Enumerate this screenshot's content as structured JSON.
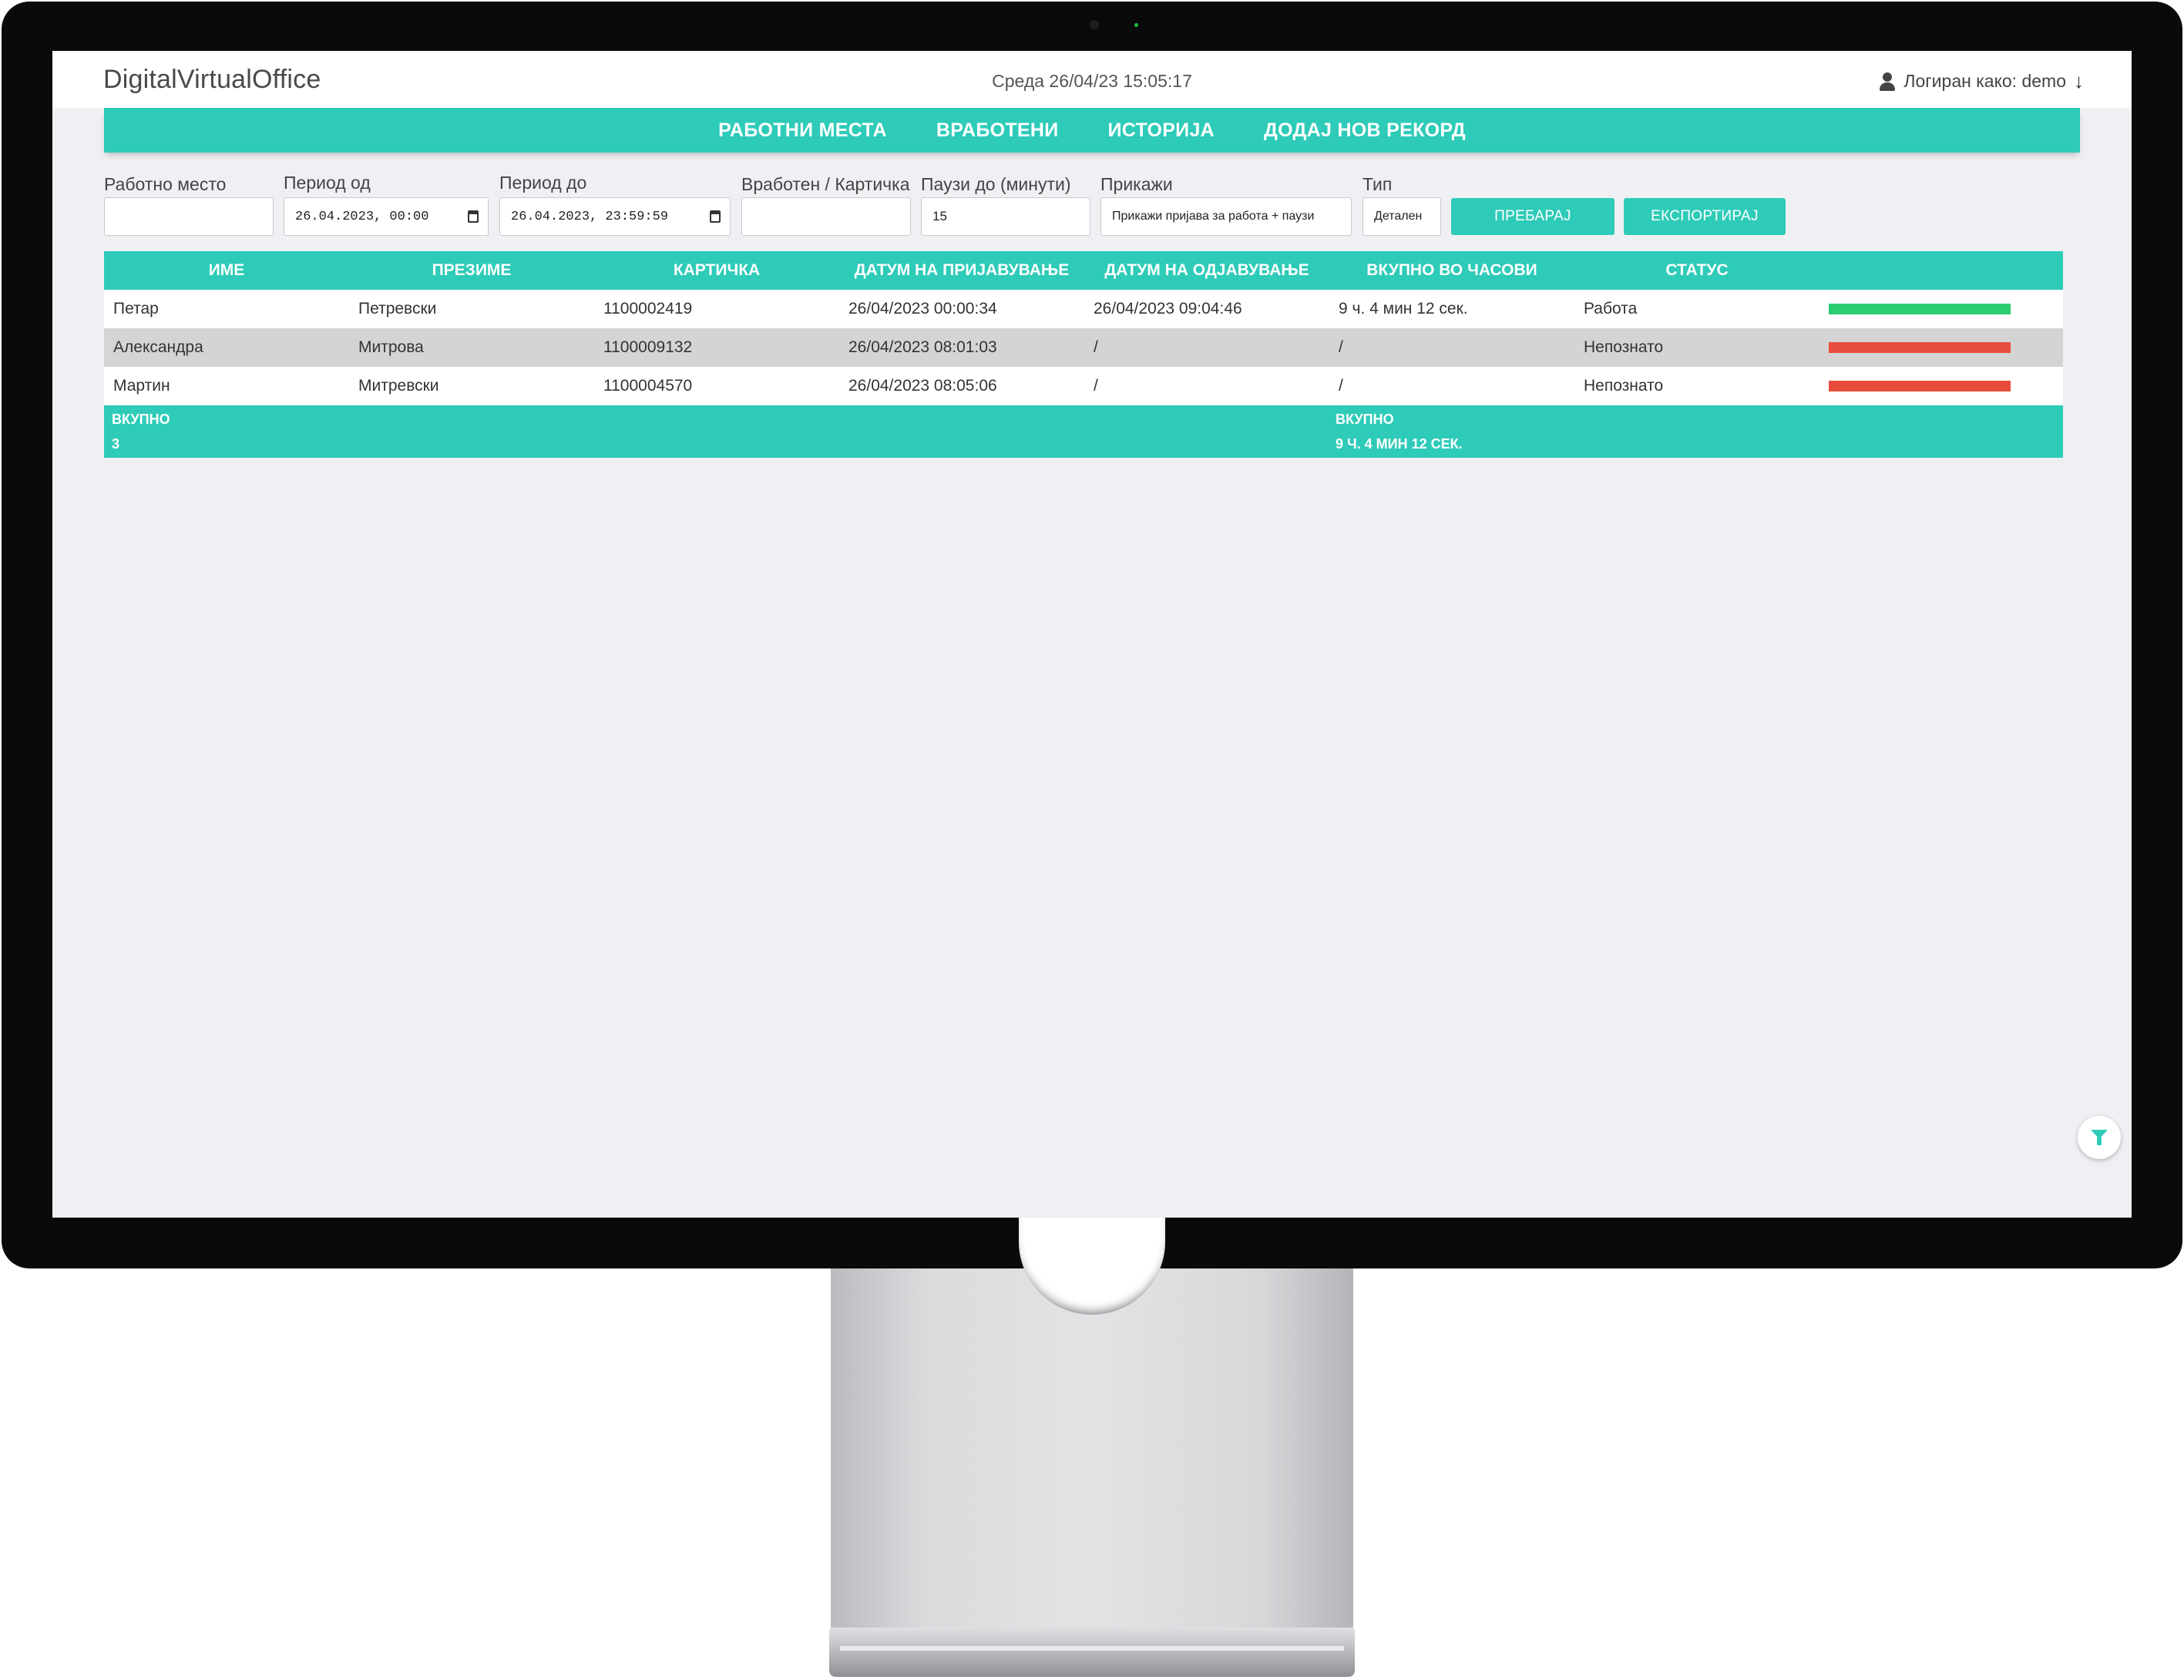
{
  "header": {
    "brand": "DigitalVirtualOffice",
    "clock": "Среда 26/04/23 15:05:17",
    "user": "Логиран како: demo"
  },
  "nav": [
    "РАБОТНИ МЕСТА",
    "ВРАБОТЕНИ",
    "ИСТОРИЈА",
    "ДОДАЈ НОВ РЕКОРД"
  ],
  "filters": {
    "workplace": {
      "label": "Работно место",
      "value": ""
    },
    "period_from": {
      "label": "Период од",
      "value": "26.04.2023, 00:00"
    },
    "period_to": {
      "label": "Период до",
      "value": "26.04.2023, 23:59:59"
    },
    "employee": {
      "label": "Вработен / Картичка",
      "value": ""
    },
    "breaks": {
      "label": "Паузи до (минути)",
      "value": "15"
    },
    "show": {
      "label": "Прикажи",
      "value": "Прикажи пријава за работа + паузи"
    },
    "type": {
      "label": "Тип",
      "value": "Детален"
    },
    "search_button": "ПРЕБАРАЈ",
    "export_button": "ЕКСПОРТИРАЈ"
  },
  "table": {
    "columns": [
      "ИМЕ",
      "ПРЕЗИМЕ",
      "КАРТИЧКА",
      "ДАТУМ НА ПРИЈАВУВАЊЕ",
      "ДАТУМ НА ОДЈАВУВАЊЕ",
      "ВКУПНО ВО ЧАСОВИ",
      "СТАТУС"
    ],
    "rows": [
      {
        "first": "Петар",
        "last": "Петревски",
        "card": "1100002419",
        "login": "26/04/2023 00:00:34",
        "logout": "26/04/2023 09:04:46",
        "total": "9 ч. 4 мин 12 сек.",
        "status": "Работа"
      },
      {
        "first": "Александра",
        "last": "Митрова",
        "card": "1100009132",
        "login": "26/04/2023 08:01:03",
        "logout": "/",
        "total": "/",
        "status": "Непознато"
      },
      {
        "first": "Мартин",
        "last": "Митревски",
        "card": "1100004570",
        "login": "26/04/2023 08:05:06",
        "logout": "/",
        "total": "/",
        "status": "Непознато"
      }
    ],
    "footer": {
      "count_label": "ВКУПНО",
      "count_value": "3",
      "total_label": "ВКУПНО",
      "total_value": "9 Ч. 4 МИН 12 СЕК."
    }
  },
  "colors": {
    "accent": "#2ecbb8",
    "status_work": "#2ecc71",
    "status_unknown": "#e74c3c"
  },
  "icons": [
    "user-icon",
    "arrow-down-icon",
    "calendar-icon",
    "filter-icon"
  ]
}
